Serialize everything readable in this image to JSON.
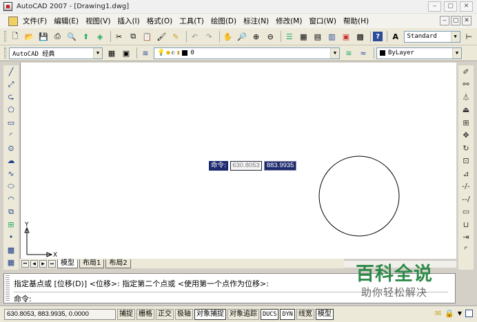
{
  "window": {
    "title": "AutoCAD 2007 - [Drawing1.dwg]",
    "controls": [
      "‒",
      "▢",
      "✕"
    ]
  },
  "menu": {
    "items": [
      "文件(F)",
      "编辑(E)",
      "视图(V)",
      "插入(I)",
      "格式(O)",
      "工具(T)",
      "绘图(D)",
      "标注(N)",
      "修改(M)",
      "窗口(W)",
      "帮助(H)"
    ],
    "doc_controls": [
      "‒",
      "▢",
      "✕"
    ]
  },
  "toolbar1": {
    "text_style": "Standard"
  },
  "toolbar2": {
    "workspace": "AutoCAD 经典",
    "layer": "0",
    "color": "ByLayer"
  },
  "draw_tools": [
    "line-icon",
    "construction-line-icon",
    "polyline-icon",
    "polygon-icon",
    "rectangle-icon",
    "arc-icon",
    "circle-icon",
    "revision-cloud-icon",
    "spline-icon",
    "ellipse-icon",
    "ellipse-arc-icon",
    "insert-block-icon",
    "make-block-icon",
    "point-icon",
    "hatch-icon",
    "table-icon"
  ],
  "modify_tools": [
    "erase-icon",
    "copy-icon",
    "mirror-icon",
    "offset-icon",
    "array-icon",
    "move-icon",
    "rotate-icon",
    "scale-icon",
    "stretch-icon",
    "trim-icon",
    "extend-icon",
    "break-icon",
    "join-icon",
    "chamfer-icon",
    "fillet-icon"
  ],
  "dynamic_input": {
    "prompt": "命令:",
    "x_value": "630.8053",
    "y_value": "883.9935"
  },
  "ucs": {
    "x_label": "X",
    "y_label": "Y"
  },
  "layout_tabs": {
    "items": [
      "模型",
      "布局1",
      "布局2"
    ],
    "active": "模型"
  },
  "command": {
    "history_line": "指定基点或 [位移(D)] <位移>:  指定第二个点或 <使用第一个点作为位移>:",
    "prompt_line": "命令:"
  },
  "watermark": {
    "brand": "百科全说",
    "slogan": "助你轻松解决"
  },
  "status": {
    "coordinates": "630.8053, 883.9935, 0.0000",
    "toggles": [
      {
        "label": "捕捉",
        "on": false
      },
      {
        "label": "栅格",
        "on": false
      },
      {
        "label": "正交",
        "on": false
      },
      {
        "label": "极轴",
        "on": false
      },
      {
        "label": "对象捕捉",
        "on": true
      },
      {
        "label": "对象追踪",
        "on": false
      },
      {
        "label": "DUCS",
        "on": true
      },
      {
        "label": "DYN",
        "on": true
      },
      {
        "label": "线宽",
        "on": false
      },
      {
        "label": "模型",
        "on": true
      }
    ]
  }
}
